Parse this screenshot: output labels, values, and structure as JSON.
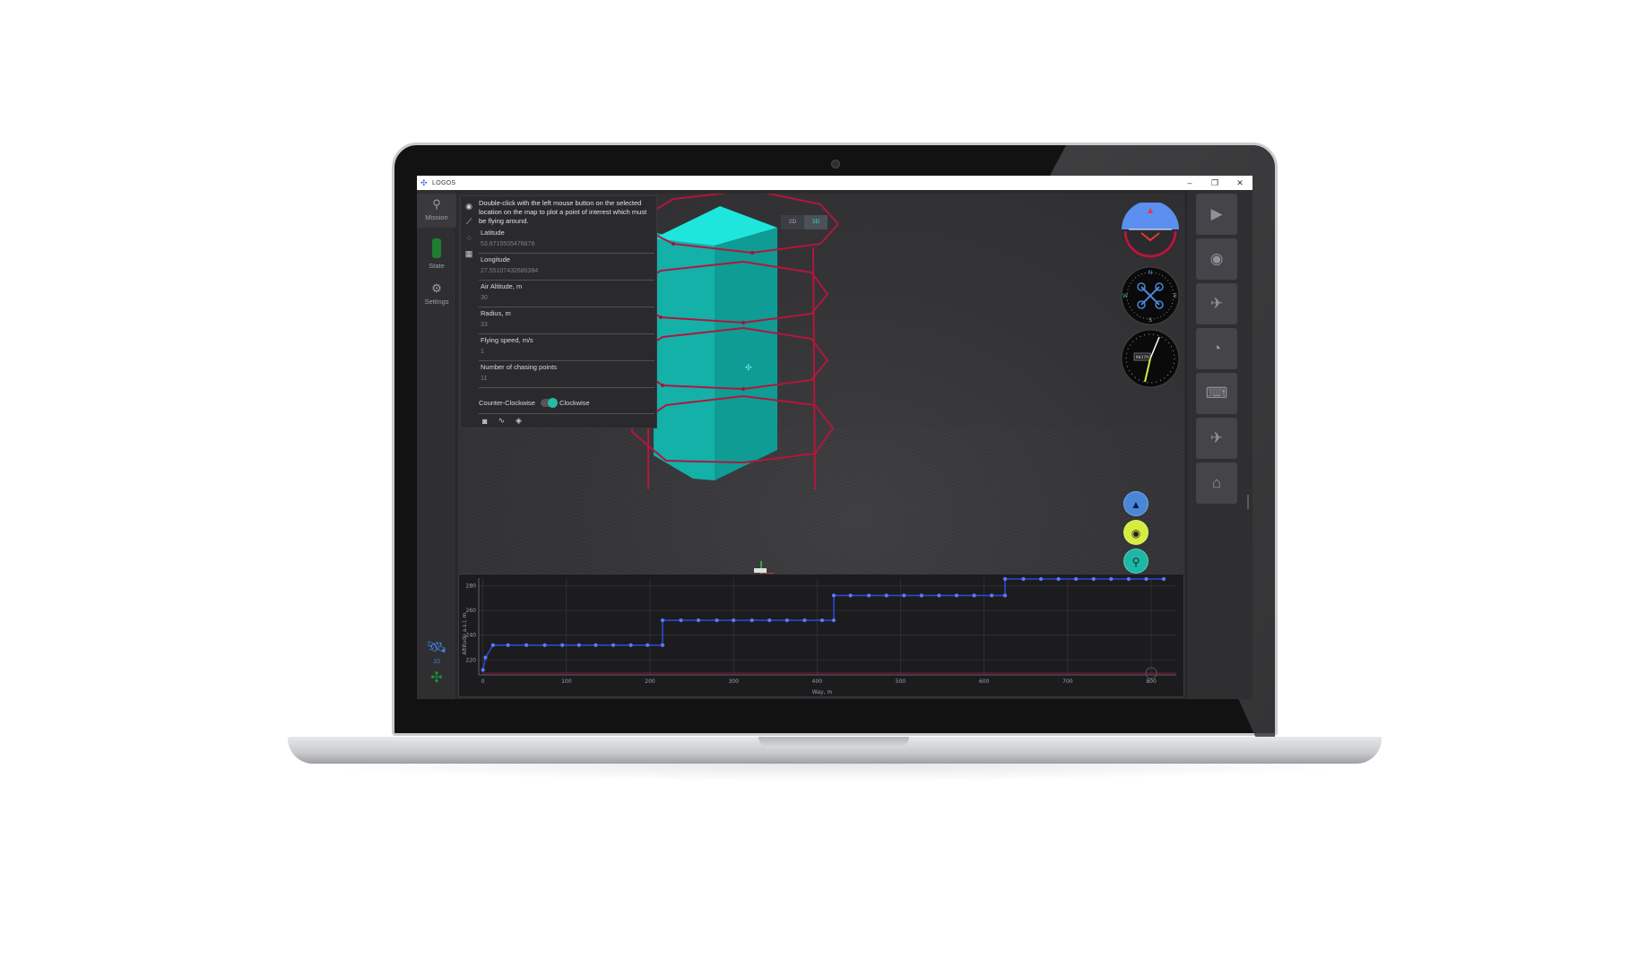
{
  "app": {
    "title": "LOGOS",
    "logo_icon": "drone-logo-icon",
    "window_buttons": [
      "–",
      "❐",
      "✕"
    ]
  },
  "left_rail": {
    "items": [
      {
        "label": "Mission",
        "icon": "map-pin-icon",
        "active": true
      },
      {
        "label": "State",
        "icon": "state-indicator-icon"
      },
      {
        "label": "Settings",
        "icon": "gears-icon"
      }
    ],
    "satellites": {
      "count": "10",
      "icon": "satellite-icon"
    },
    "connection_icon": "drone-connection-icon"
  },
  "poi_panel": {
    "hint": "Double-click with the left mouse button on the selected location on the map to plot a point of interest which must be flying around.",
    "fields": [
      {
        "label": "Latitude",
        "value": "53.8715505476676"
      },
      {
        "label": "Longitude",
        "value": "27.55107432680384"
      },
      {
        "label": "Air Altitude, m",
        "value": "30"
      },
      {
        "label": "Radius, m",
        "value": "33"
      },
      {
        "label": "Flying speed, m/s",
        "value": "1"
      },
      {
        "label": "Number of chasing points",
        "value": "11"
      }
    ],
    "direction": {
      "left": "Counter-Clockwise",
      "right": "Clockwise",
      "selected": "Clockwise"
    },
    "side_icons": [
      "eye-icon",
      "route-icon",
      "circle-target-icon",
      "calculator-icon"
    ],
    "footer_icons": [
      "camera-icon",
      "waveform-icon",
      "layers-icon"
    ]
  },
  "view_toggle": {
    "options": [
      "2D",
      "3D"
    ],
    "selected": "3D"
  },
  "instruments": {
    "attitude_icon": "attitude-indicator-icon",
    "compass_icon": "compass-icon",
    "compass_letters": [
      "N",
      "E",
      "S",
      "W"
    ],
    "altimeter_icon": "altimeter-icon",
    "altimeter_readout": "9837ft"
  },
  "map_buttons": [
    {
      "icon": "navigate-arrow-icon",
      "color": "#4a86d8"
    },
    {
      "icon": "target-icon",
      "color": "#d6ec3f"
    },
    {
      "icon": "location-pin-icon",
      "color": "#1fb8a6"
    }
  ],
  "right_rail": {
    "buttons": [
      {
        "name": "start-mission-button",
        "icon": "play-icon"
      },
      {
        "name": "stop-button",
        "icon": "stop-icon"
      },
      {
        "name": "takeoff-button",
        "icon": "takeoff-icon"
      },
      {
        "name": "speed-button",
        "icon": "speedometer-icon"
      },
      {
        "name": "gamepad-button",
        "icon": "gamepad-icon"
      },
      {
        "name": "landing-button",
        "icon": "landing-icon"
      },
      {
        "name": "land-home-button",
        "icon": "home-landing-icon"
      }
    ]
  },
  "colors": {
    "column": "#12b5ad",
    "column_top": "#1ee6dc",
    "orbit": "#b3163d",
    "chart_series": "#2d45d6",
    "chart_point": "#5b7cf0",
    "accent": "#26b8a8"
  },
  "chart_data": {
    "type": "line",
    "title": "",
    "xlabel": "Way, m",
    "ylabel": "Altitude a.s.l, m",
    "xlim": [
      -5,
      830
    ],
    "ylim": [
      208,
      286
    ],
    "xticks": [
      0,
      100,
      200,
      300,
      400,
      500,
      600,
      700,
      800
    ],
    "yticks": [
      220,
      240,
      260,
      280
    ],
    "grid": true,
    "series": [
      {
        "step": true,
        "points": [
          [
            0,
            212
          ],
          [
            3,
            222
          ],
          [
            12,
            232
          ],
          [
            30,
            232
          ],
          [
            52,
            232
          ],
          [
            74,
            232
          ],
          [
            95,
            232
          ],
          [
            115,
            232
          ],
          [
            135,
            232
          ],
          [
            156,
            232
          ],
          [
            177,
            232
          ],
          [
            197,
            232
          ],
          [
            215,
            232
          ],
          [
            215,
            252
          ],
          [
            237,
            252
          ],
          [
            258,
            252
          ],
          [
            280,
            252
          ],
          [
            300,
            252
          ],
          [
            322,
            252
          ],
          [
            343,
            252
          ],
          [
            364,
            252
          ],
          [
            385,
            252
          ],
          [
            406,
            252
          ],
          [
            420,
            252
          ],
          [
            420,
            272
          ],
          [
            440,
            272
          ],
          [
            462,
            272
          ],
          [
            483,
            272
          ],
          [
            504,
            272
          ],
          [
            525,
            272
          ],
          [
            546,
            272
          ],
          [
            567,
            272
          ],
          [
            588,
            272
          ],
          [
            609,
            272
          ],
          [
            625,
            272
          ],
          [
            625,
            292
          ],
          [
            647,
            292
          ],
          [
            668,
            292
          ],
          [
            689,
            292
          ],
          [
            710,
            292
          ],
          [
            731,
            292
          ],
          [
            752,
            292
          ],
          [
            773,
            292
          ],
          [
            794,
            292
          ],
          [
            815,
            292
          ]
        ]
      },
      {
        "name_hidden": true,
        "points": [
          [
            0,
            208
          ],
          [
            830,
            208
          ]
        ]
      }
    ]
  }
}
